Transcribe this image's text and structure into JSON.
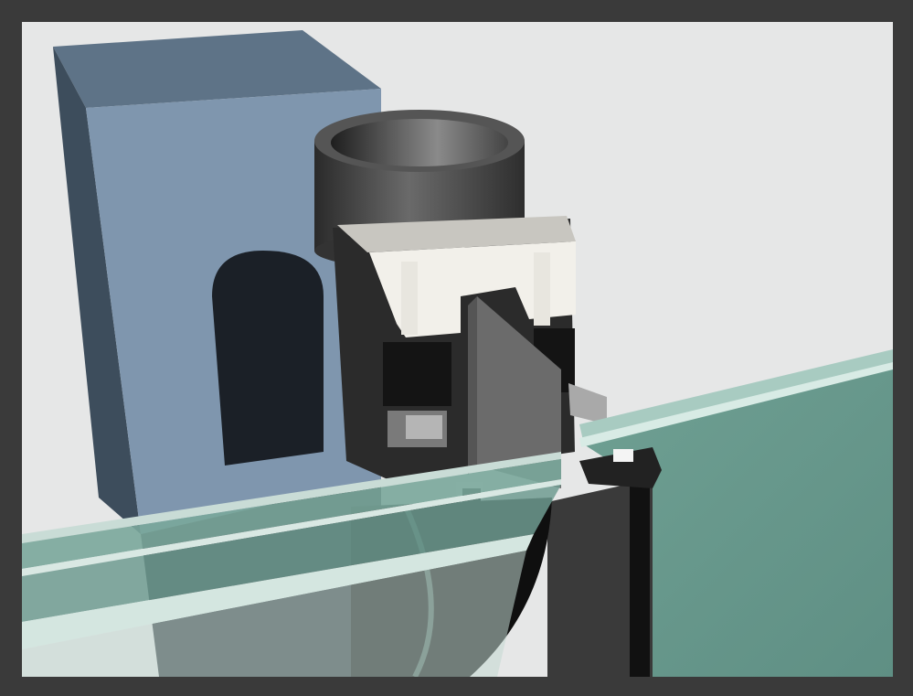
{
  "viewport": {
    "background": "#e6e7e7",
    "frame_color": "#3a3a3a"
  },
  "palette": {
    "column_front": "#7f96ae",
    "column_side": "#4a5b6c",
    "column_top": "#a3b6c8",
    "glass": "#7aa79b",
    "glass_edge": "#c9dcd6",
    "tube": "#3b3b3b",
    "profile_light": "#f2f0ea",
    "profile_dark": "#262626",
    "gasket": "#111111"
  },
  "scene": {
    "subject": "curtain-wall-mullion-section",
    "elements": [
      "concrete-column",
      "round-steel-tube",
      "aluminium-mullion-profile",
      "glass-pane-left",
      "glass-pane-right",
      "pressure-plate",
      "rubber-gaskets"
    ]
  }
}
